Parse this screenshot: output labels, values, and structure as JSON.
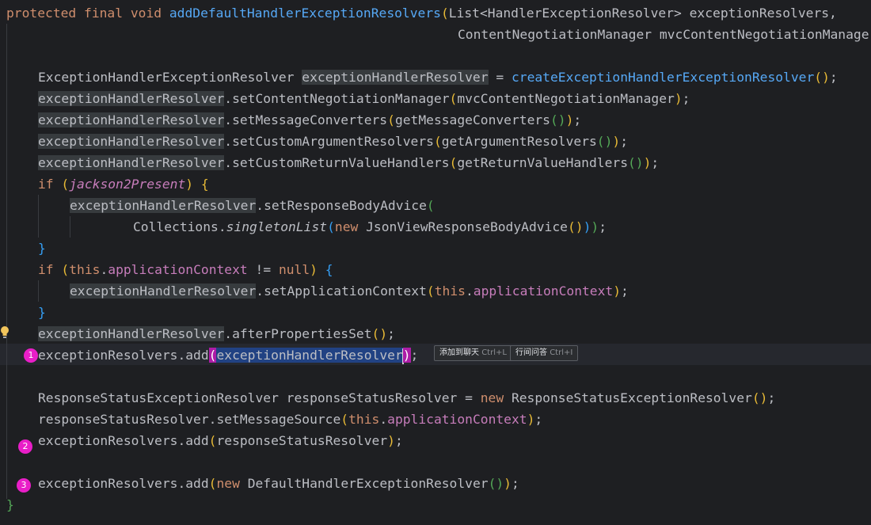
{
  "editor": {
    "lines": {
      "l1": {
        "t1": "protected final void ",
        "t2": "addDefaultHandlerExceptionResolvers",
        "t3": "(",
        "t4": "List<HandlerExceptionResolver> exceptionResolvers,"
      },
      "l2": {
        "t1": "ContentNegotiationManager mvcContentNegotiationManage"
      },
      "l3": {
        "t1": "ExceptionHandlerExceptionResolver ",
        "t2": "exceptionHandlerResolver",
        "t3": " = ",
        "t4": "createExceptionHandlerExceptionResolver",
        "t5": "()",
        "t6": ";"
      },
      "l4": {
        "t1": "exceptionHandlerResolver",
        "t2": ".",
        "t3": "setContentNegotiationManager",
        "t4": "(",
        "t5": "mvcContentNegotiationManager",
        "t6": ")",
        "t7": ";"
      },
      "l5": {
        "t1": "exceptionHandlerResolver",
        "t2": ".setMessageConverters",
        "t3": "(",
        "t4": "getMessageConverters",
        "t5": "()",
        "t6": ")",
        "t7": ";"
      },
      "l6": {
        "t1": "exceptionHandlerResolver",
        "t2": ".setCustomArgumentResolvers",
        "t3": "(",
        "t4": "getArgumentResolvers",
        "t5": "()",
        "t6": ")",
        "t7": ";"
      },
      "l7": {
        "t1": "exceptionHandlerResolver",
        "t2": ".setCustomReturnValueHandlers",
        "t3": "(",
        "t4": "getReturnValueHandlers",
        "t5": "()",
        "t6": ")",
        "t7": ";"
      },
      "l8": {
        "t1": "if ",
        "t2": "(",
        "t3": "jackson2Present",
        "t4": ")",
        "t5": " ",
        "t6": "{"
      },
      "l9": {
        "t1": "exceptionHandlerResolver",
        "t2": ".setResponseBodyAdvice",
        "t3": "("
      },
      "l10": {
        "t1": "Collections.",
        "t2": "singletonList",
        "t3": "(",
        "t4": "new ",
        "t5": "JsonViewResponseBodyAdvice",
        "t6": "()",
        "t7": ")",
        "t8": ")",
        "t9": ";"
      },
      "l11": {
        "t1": "}"
      },
      "l12": {
        "t1": "if ",
        "t2": "(",
        "t3": "this",
        "t4": ".",
        "t5": "applicationContext",
        "t6": " != ",
        "t7": "null",
        "t8": ")",
        "t9": " ",
        "t10": "{"
      },
      "l13": {
        "t1": "exceptionHandlerResolver",
        "t2": ".setApplicationContext",
        "t3": "(",
        "t4": "this",
        "t5": ".",
        "t6": "applicationContext",
        "t7": ")",
        "t8": ";"
      },
      "l14": {
        "t1": "}"
      },
      "l15": {
        "t1": "exceptionHandlerResolver",
        "t2": ".afterPropertiesSet",
        "t3": "()",
        "t4": ";"
      },
      "l16": {
        "t1": "exceptionResolvers.add",
        "t2": "(",
        "t3": "exceptionHandlerResolver",
        "t4": ")",
        "t5": ";"
      },
      "l18": {
        "t1": "ResponseStatusExceptionResolver responseStatusResolver = ",
        "t2": "new ",
        "t3": "ResponseStatusExceptionResolver",
        "t4": "()",
        "t5": ";"
      },
      "l19": {
        "t1": "responseStatusResolver.setMessageSource",
        "t2": "(",
        "t3": "this",
        "t4": ".",
        "t5": "applicationContext",
        "t6": ")",
        "t7": ";"
      },
      "l20": {
        "t1": "exceptionResolvers.add",
        "t2": "(",
        "t3": "responseStatusResolver",
        "t4": ")",
        "t5": ";"
      },
      "l22": {
        "t1": "exceptionResolvers.add",
        "t2": "(",
        "t3": "new ",
        "t4": "DefaultHandlerExceptionResolver",
        "t5": "()",
        "t6": ")",
        "t7": ";"
      },
      "l23": {
        "t1": "}"
      }
    },
    "hints": {
      "add_to_chat": {
        "label": "添加到聊天",
        "shortcut": "Ctrl+L"
      },
      "inline_ask": {
        "label": "行间问答",
        "shortcut": "Ctrl+I"
      }
    },
    "markers": [
      "1",
      "2",
      "3"
    ],
    "colors": {
      "background": "#1e1f22",
      "keyword": "#cf8e6d",
      "method": "#56a8f5",
      "field": "#c77dbb",
      "selection": "#214283",
      "marker": "#e91ec8"
    }
  }
}
